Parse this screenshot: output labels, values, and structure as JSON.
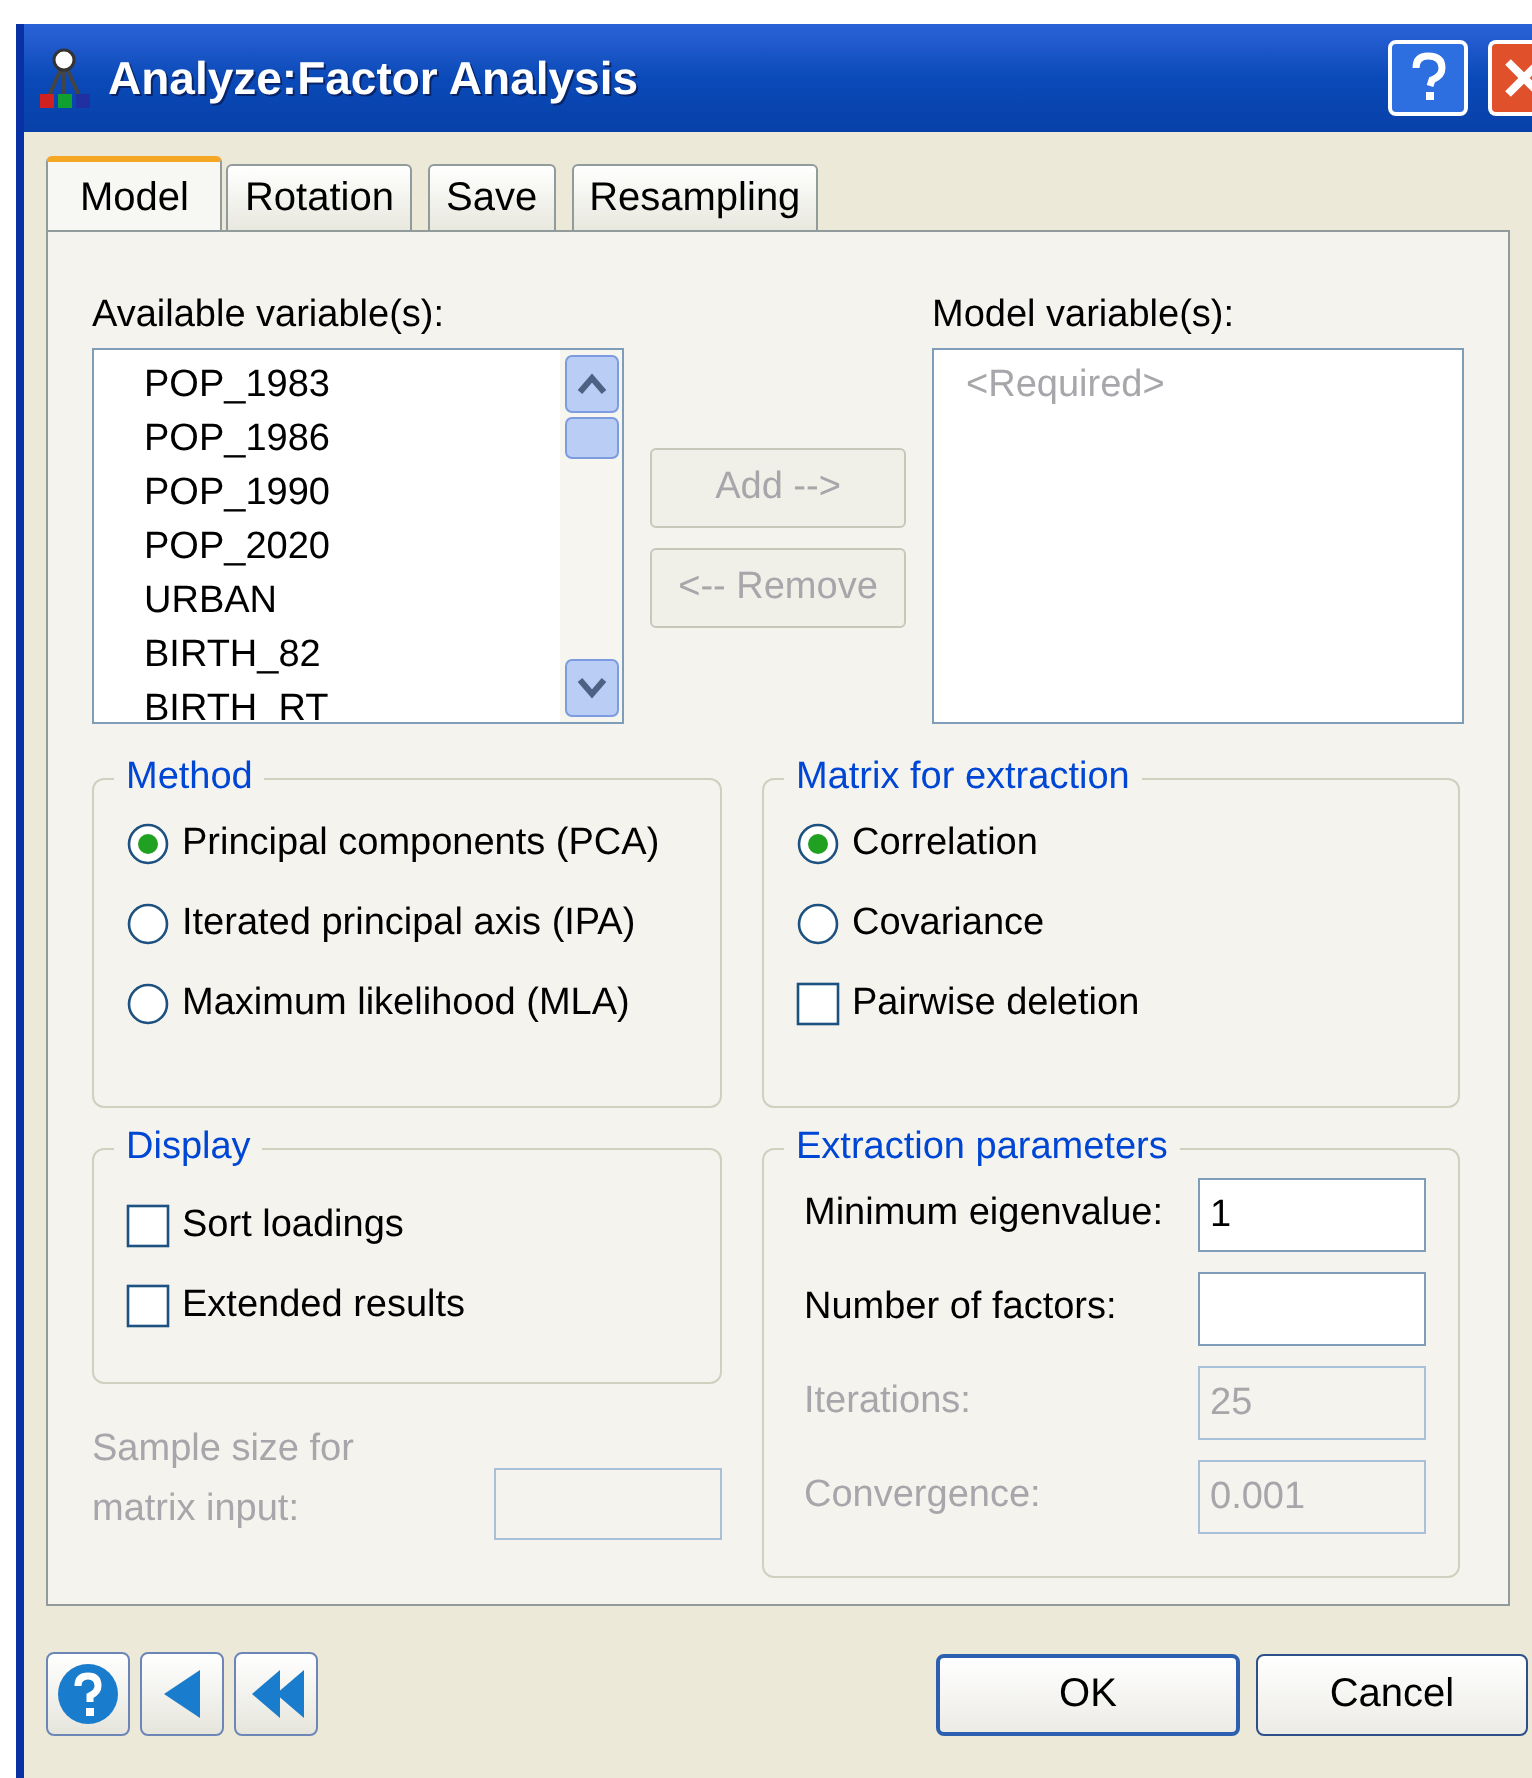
{
  "window": {
    "title": "Analyze:Factor Analysis"
  },
  "tabs": [
    {
      "label": "Model",
      "selected": true
    },
    {
      "label": "Rotation",
      "selected": false
    },
    {
      "label": "Save",
      "selected": false
    },
    {
      "label": "Resampling",
      "selected": false
    }
  ],
  "available_variables": {
    "label": "Available variable(s):",
    "items": [
      "POP_1983",
      "POP_1986",
      "POP_1990",
      "POP_2020",
      "URBAN",
      "BIRTH_82",
      "BIRTH_RT"
    ]
  },
  "transfer_buttons": [
    {
      "label": "Add -->",
      "disabled": true
    },
    {
      "label": "<-- Remove",
      "disabled": true
    }
  ],
  "model_variables": {
    "label": "Model variable(s):",
    "placeholder": "<Required>"
  },
  "method": {
    "title": "Method",
    "options": [
      {
        "label": "Principal components (PCA)",
        "selected": true
      },
      {
        "label": "Iterated principal axis (IPA)",
        "selected": false
      },
      {
        "label": "Maximum likelihood (MLA)",
        "selected": false
      }
    ]
  },
  "matrix_for_extraction": {
    "title": "Matrix for extraction",
    "options": [
      {
        "kind": "radio",
        "label": "Correlation",
        "selected": true
      },
      {
        "kind": "radio",
        "label": "Covariance",
        "selected": false
      },
      {
        "kind": "checkbox",
        "label": "Pairwise deletion",
        "checked": false
      }
    ]
  },
  "display": {
    "title": "Display",
    "options": [
      {
        "label": "Sort loadings",
        "checked": false
      },
      {
        "label": "Extended results",
        "checked": false
      }
    ]
  },
  "extraction_parameters": {
    "title": "Extraction parameters",
    "fields": [
      {
        "label": "Minimum eigenvalue:",
        "value": "1",
        "disabled": false
      },
      {
        "label": "Number of factors:",
        "disabled": false
      },
      {
        "label": "Iterations:",
        "value": "25",
        "disabled": true
      },
      {
        "label": "Convergence:",
        "value": "0.001",
        "disabled": true
      }
    ]
  },
  "sample_size": {
    "label": "Sample size for matrix input:",
    "disabled": true
  },
  "dialog_buttons": [
    {
      "label": "OK",
      "default": true
    },
    {
      "label": "Cancel",
      "default": false
    }
  ]
}
